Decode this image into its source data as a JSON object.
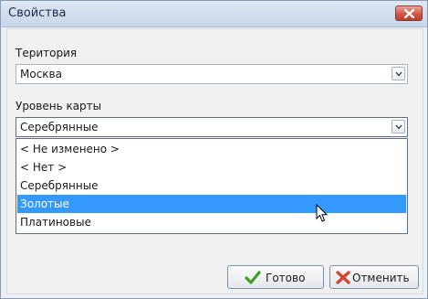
{
  "window": {
    "title": "Свойства"
  },
  "territory": {
    "label": "Територия",
    "value": "Москва"
  },
  "card_level": {
    "label": "Уровень карты",
    "value": "Серебрянные",
    "options": [
      "< Не изменено >",
      "< Нет >",
      "Серебрянные",
      "Золотые",
      "Платиновые"
    ],
    "selected_option": "Золотые"
  },
  "buttons": {
    "ok_label": "Готово",
    "cancel_label": "Отменить"
  },
  "colors": {
    "selection": "#3399ff",
    "close": "#cf5848",
    "ok_icon": "#3f9f27",
    "cancel_icon": "#d9432c"
  }
}
